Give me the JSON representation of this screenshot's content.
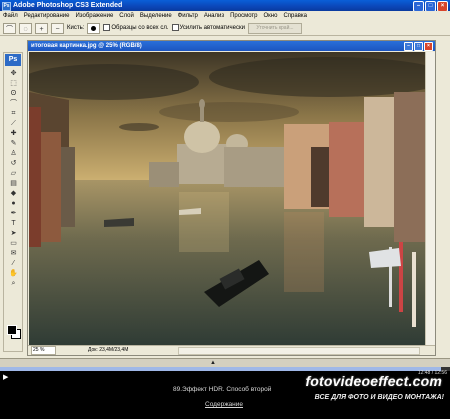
{
  "window": {
    "title": "Adobe Photoshop CS3 Extended",
    "logo": "Ps"
  },
  "menu": [
    "Файл",
    "Редактирование",
    "Изображение",
    "Слой",
    "Выделение",
    "Фильтр",
    "Анализ",
    "Просмотр",
    "Окно",
    "Справка"
  ],
  "options": {
    "brushes_label": "Кисть:",
    "sample_all_layers": "Образцы со всех сл.",
    "auto_enhance": "Усилить автоматически",
    "refine_edge": "Уточнить край..."
  },
  "document": {
    "title": "итоговая картинка.jpg @ 25% (RGB/8)",
    "zoom": "25 %",
    "doc_size": "Док: 23,4M/23,4M"
  },
  "player": {
    "time": "12:48 / 12:56",
    "progress_fraction": 0.98,
    "caption": "89.Эффект HDR. Способ второй",
    "contents_link": "Содержание",
    "brand": "fotovideoeffect.com",
    "tagline": "ВСЕ ДЛЯ ФОТО И ВИДЕО МОНТАЖА!"
  }
}
